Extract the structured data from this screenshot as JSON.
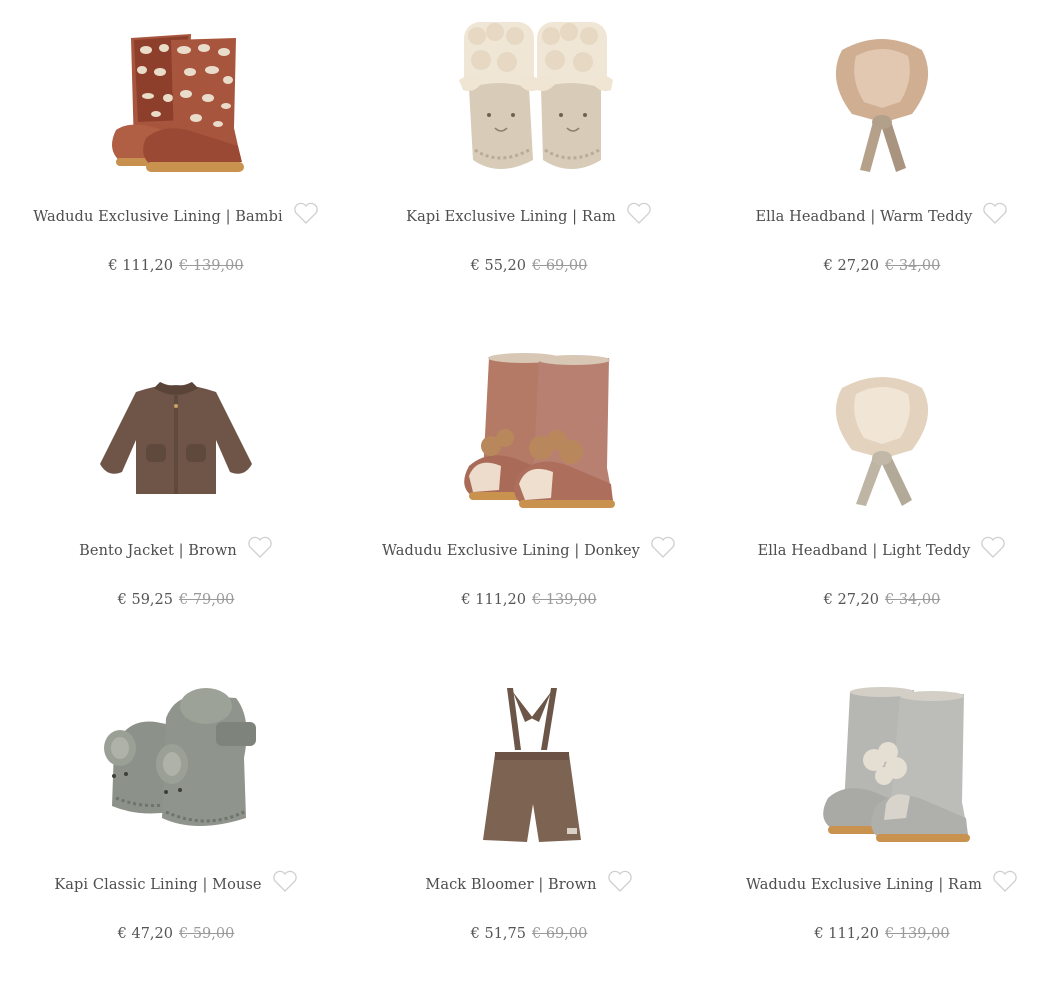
{
  "currency": "€",
  "products": [
    {
      "title": "Wadudu Exclusive Lining | Bambi",
      "price": "€ 111,20",
      "old_price": "€ 139,00",
      "image": "boots-leopard"
    },
    {
      "title": "Kapi Exclusive Lining | Ram",
      "price": "€ 55,20",
      "old_price": "€ 69,00",
      "image": "booties-ram"
    },
    {
      "title": "Ella Headband | Warm Teddy",
      "price": "€ 27,20",
      "old_price": "€ 34,00",
      "image": "fur-collar-warm"
    },
    {
      "title": "Bento Jacket | Brown",
      "price": "€ 59,25",
      "old_price": "€ 79,00",
      "image": "teddy-jacket"
    },
    {
      "title": "Wadudu Exclusive Lining | Donkey",
      "price": "€ 111,20",
      "old_price": "€ 139,00",
      "image": "boots-donkey"
    },
    {
      "title": "Ella Headband | Light Teddy",
      "price": "€ 27,20",
      "old_price": "€ 34,00",
      "image": "fur-collar-light"
    },
    {
      "title": "Kapi Classic Lining | Mouse",
      "price": "€ 47,20",
      "old_price": "€ 59,00",
      "image": "booties-mouse"
    },
    {
      "title": "Mack Bloomer | Brown",
      "price": "€ 51,75",
      "old_price": "€ 69,00",
      "image": "bloomer-shorts"
    },
    {
      "title": "Wadudu Exclusive Lining | Ram",
      "price": "€ 111,20",
      "old_price": "€ 139,00",
      "image": "boots-ram-grey"
    }
  ],
  "colors": {
    "text": "#4d4d4d",
    "old_price": "#9a9a9a",
    "heart_outline": "#cfcfcf"
  }
}
